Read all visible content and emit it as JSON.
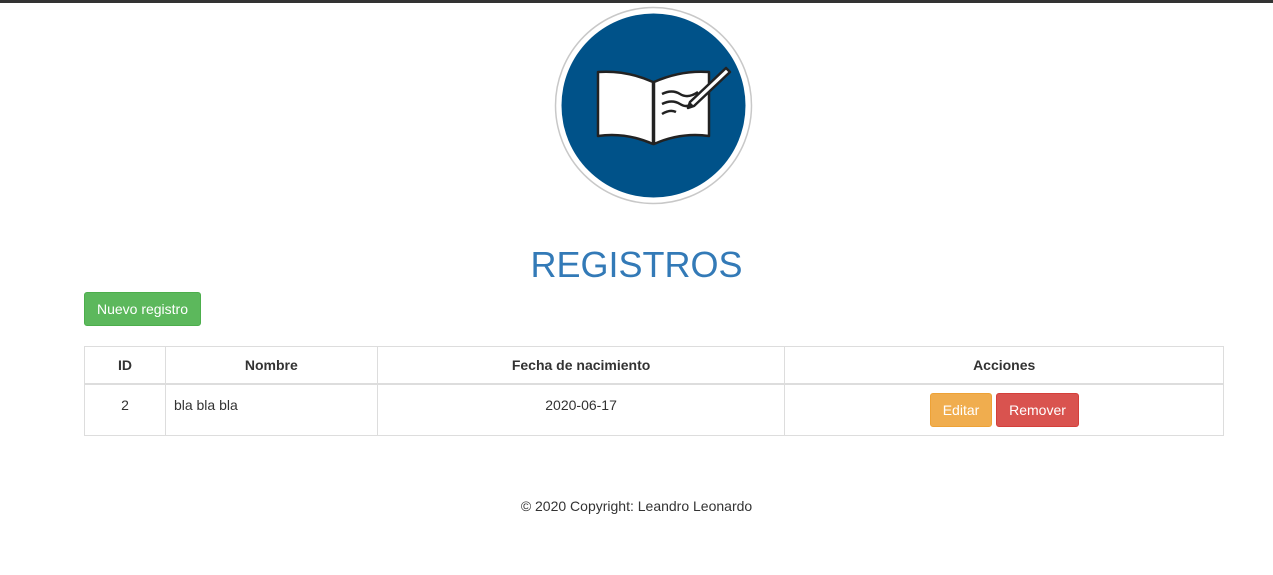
{
  "header": {
    "logo_icon": "book-writing-logo-icon",
    "title": "REGISTROS"
  },
  "toolbar": {
    "new_label": "Nuevo registro"
  },
  "table": {
    "columns": [
      "ID",
      "Nombre",
      "Fecha de nacimiento",
      "Acciones"
    ],
    "rows": [
      {
        "id": "2",
        "nombre": "bla bla bla",
        "fecha": "2020-06-17",
        "edit_label": "Editar",
        "remove_label": "Remover"
      }
    ]
  },
  "footer": {
    "copyright": "© 2020 Copyright: Leandro Leonardo"
  },
  "colors": {
    "title": "#337ab7",
    "logo_blue": "#005289",
    "btn_success": "#5cb85c",
    "btn_warning": "#f0ad4e",
    "btn_danger": "#d9534f"
  }
}
